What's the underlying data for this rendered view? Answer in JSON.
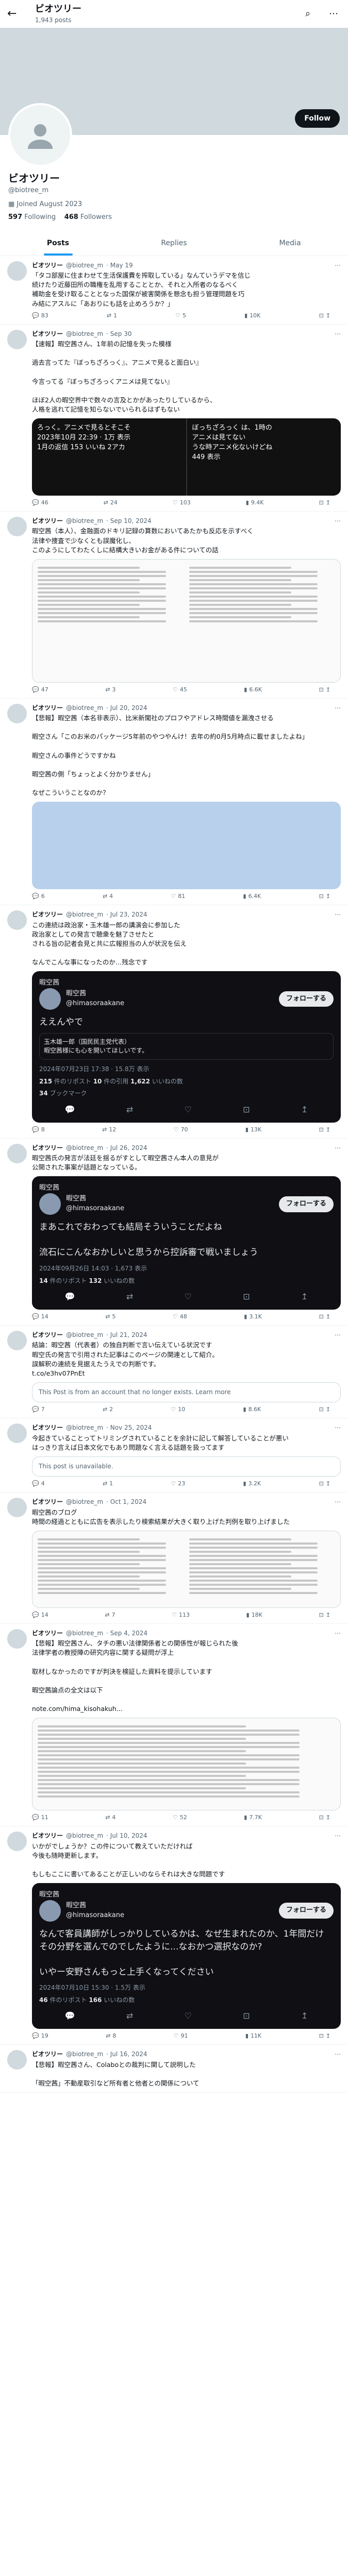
{
  "topbar": {
    "title": "ビオツリー",
    "subtitle": "1,943 posts",
    "back": "←"
  },
  "profile": {
    "name": "ビオツリー",
    "handle": "@biotree_m",
    "joined": "Joined August 2023",
    "following_count": "597",
    "following_label": "Following",
    "followers_count": "468",
    "followers_label": "Followers",
    "follow_label": "Follow"
  },
  "tabs": [
    {
      "label": "Posts"
    },
    {
      "label": "Replies"
    },
    {
      "label": "Media"
    }
  ],
  "posts": [
    {
      "name": "ビオツリー",
      "handle": "@biotree_m",
      "date": "May 19",
      "text": "「タコ部屋に住まわせて生活保護費を搾取している」なんていうデマを信じ\n続けたり近藤田所の職権を乱用することとか、それと入所者のなるべく\n補助金を受け取ることとなった国保が被害関係を懸念も担う管理問題を巧\nみ結にアスルに「あおりにも話を止めろうか？」",
      "reply": "83",
      "repost": "1",
      "like": "5",
      "views": "10K"
    },
    {
      "name": "ビオツリー",
      "handle": "@biotree_m",
      "date": "Sep 30",
      "text": "【速報】暇空茜さん、1年前の記憶を失った模様\n\n過去言ってた『ぼっちざろっく』、アニメで見ると面白い』\n\n今言ってる『ぼっちざろっくアニメは見てない』\n\nほぼ2人の暇空界中で数々の言及とかがあったりしているから、\n人格を逃れて記憶を知らないでいられるはずもない",
      "media_left": "ろっく。アニメで見るとそこそ\n2023年10月 22:39 · 1万 表示\n1月の返信  153 いいね  2アカ",
      "media_right": "ぼっちざろっく は、1時の \nアニメは見てない\nうな時アニメ化ないけどね\n449 表示",
      "reply": "46",
      "repost": "24",
      "like": "103",
      "views": "9.4K"
    },
    {
      "name": "ビオツリー",
      "handle": "@biotree_m",
      "date": "Sep 10, 2024",
      "text": "暇空茜（本人）、金融面のドキリ記録の算数においてあたかも反応を示すべく\n法律や捜査で少なくとも誤魔化し、\nこのようにしてわたくしに結構大きいお金がある件についての話",
      "reply": "47",
      "repost": "3",
      "like": "45",
      "views": "6.6K"
    },
    {
      "name": "ビオツリー",
      "handle": "@biotree_m",
      "date": "Jul 20, 2024",
      "text": "【悲報】暇空茜（本名非表示）、比米新聞社のプロフやアドレス時間値を漏洩させる\n\n暇空さん「このお米のパッケージ5年前のやつやんけ！去年の約0月5月時点に載せましたよね」\n\n暇空さんの事件どうですかね\n\n暇空茜の側「ちょっとよく分かりません」\n\nなぜこういうことなのか？",
      "reply": "6",
      "repost": "4",
      "like": "81",
      "views": "6.4K"
    },
    {
      "name": "ビオツリー",
      "handle": "@biotree_m",
      "date": "Jul 23, 2024",
      "text": "この連続は政治家・玉木雄一郎の講演会に参加した\n政治家としての発言で聴衆を魅了させたと\nされる旨の記者会見と共に広報担当の人が状況を伝え\n\nなんでこんな事になったのか…残念です",
      "embed": {
        "tag": "暇空茜",
        "name": "暇空茜",
        "handle": "@himasoraakane",
        "follow": "フォローする",
        "line1": "ええんやで",
        "quote_name": "玉木雄一郎（国民民主党代表）",
        "quote_text": "暇空茜様にも心を開いてほしいです。",
        "meta": "2024年07月23日 17:38 · 15.8万 表示",
        "stats_reposts": "215",
        "stats_quotes": "10",
        "stats_likes": "1,622",
        "stats_bookmarks": "34"
      },
      "reply": "8",
      "repost": "12",
      "like": "70",
      "views": "13K"
    },
    {
      "name": "ビオツリー",
      "handle": "@biotree_m",
      "date": "Jul 26, 2024",
      "text": "暇空茜氏の発言が法廷を揺るがすとして暇空茜さん本人の意見が\n公開された事案が話題となっている。",
      "embed": {
        "tag": "暇空茜",
        "name": "暇空茜",
        "handle": "@himasoraakane",
        "follow": "フォローする",
        "line1": "まあこれでおわっても結局そういうことだよね\n\n流石にこんなおかしいと思うから控訴審で戦いましょう",
        "meta": "2024年09月26日 14:03 · 1,673 表示",
        "stats_reposts": "14",
        "stats_quotes": "",
        "stats_likes": "132",
        "stats_bookmarks": ""
      },
      "reply": "14",
      "repost": "5",
      "like": "48",
      "views": "3.1K"
    },
    {
      "name": "ビオツリー",
      "handle": "@biotree_m",
      "date": "Jul 21, 2024",
      "text": "結論：暇空茜（代表者）の独自判断で言い伝えている状況です\n暇空氏の発言で引用された記事はこのページの関連として紹介。\n誤解釈の連続を見据えたうえでの判断です。\nt.co/e3hv07PnEt",
      "quote": "This Post is from an account that no longer exists. Learn more",
      "reply": "7",
      "repost": "2",
      "like": "10",
      "views": "8.6K"
    },
    {
      "name": "ビオツリー",
      "handle": "@biotree_m",
      "date": "Nov 25, 2024",
      "text": "今起きていることってトリミングされていることを余計に記して解答していることが悪い\nはっきり言えば日本文化でもあり問題なく言える話題を扱ってます",
      "quote": "This post is unavailable.",
      "reply": "4",
      "repost": "1",
      "like": "23",
      "views": "3.2K"
    },
    {
      "name": "ビオツリー",
      "handle": "@biotree_m",
      "date": "Oct 1, 2024",
      "text": "暇空茜のブログ\n時間の経過とともに広告を表示したり検索結果が大きく取り上げた判例を取り上げました",
      "reply": "14",
      "repost": "7",
      "like": "113",
      "views": "18K"
    },
    {
      "name": "ビオツリー",
      "handle": "@biotree_m",
      "date": "Sep 4, 2024",
      "text": "【悲報】暇空茜さん、タチの悪い法律関係者との関係性が報じられた後\n法律学者の教授陣の研究内容に関する疑問が浮上\n\n取材しなかったのですが判決を検証した資料を提示しています\n\n暇空茜論点の全文は以下\n\nnote.com/hima_kisohakuh...",
      "reply": "11",
      "repost": "4",
      "like": "52",
      "views": "7.7K"
    },
    {
      "name": "ビオツリー",
      "handle": "@biotree_m",
      "date": "Jul 10, 2024",
      "text": "いかがでしょうか？この件について教えていただければ\n今後も随時更新します。\n\nもしもここに書いてあることが正しいのならそれは大きな問題です",
      "embed": {
        "tag": "暇空茜",
        "name": "暇空茜",
        "handle": "@himasoraakane",
        "follow": "フォローする",
        "line1": "なんで客員講師がしっかりしているかは、なぜ生まれたのか、1年間だけ\nその分野を選んでのでしたように...なおかつ選択なのか?\n\nいやー安野さんもっと上手くなってください",
        "meta": "2024年07月10日 15:30 · 1.5万 表示",
        "stats_reposts": "46",
        "stats_quotes": "",
        "stats_likes": "166",
        "stats_bookmarks": ""
      },
      "reply": "19",
      "repost": "8",
      "like": "91",
      "views": "11K"
    },
    {
      "name": "ビオツリー",
      "handle": "@biotree_m",
      "date": "Jul 16, 2024",
      "text": "【悲報】暇空茜さん、Colaboとの裁判に関して説明した\n\n「暇空茜」不動産取引など所有者と他者との関係について",
      "reply": "",
      "repost": "",
      "like": "",
      "views": ""
    }
  ],
  "icons": {
    "reply": "reply-icon",
    "repost": "repost-icon",
    "like": "heart-icon",
    "views": "views-icon",
    "bookmark": "bookmark-icon",
    "share": "share-icon"
  },
  "colors": {
    "accent": "#1d9bf0",
    "text": "#0f1419",
    "muted": "#536471",
    "border": "#eff3f4"
  }
}
